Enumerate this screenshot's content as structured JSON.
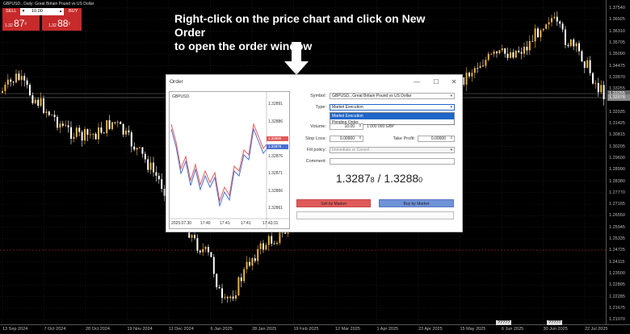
{
  "chart": {
    "symbol_info": "GBPUSD., Daily:  Great Britain Pound vs US Dollar",
    "colors": {
      "bull": "#f0b43c",
      "bear": "#ffffff",
      "grid": "#2a2a2a",
      "price_line_red": "#c72a2a"
    }
  },
  "one_click": {
    "sell_label": "SELL",
    "buy_label": "BUY",
    "lot_value": "10.00",
    "sell_price_prefix": "1.32",
    "sell_price_big": "87",
    "sell_price_sup": "8",
    "buy_price_prefix": "1.32",
    "buy_price_big": "88",
    "buy_price_sup": "0"
  },
  "instruction": {
    "line1": "Right-click on the price chart and click on New Order",
    "line2": "to open the order window"
  },
  "price_scale": {
    "ticks": [
      "1.37540",
      "1.36925",
      "1.36310",
      "1.35705",
      "1.35090",
      "1.34475",
      "1.33870",
      "1.33255",
      "1.32645",
      "1.32035",
      "1.31425",
      "1.30815",
      "1.30205",
      "1.29600",
      "1.28990",
      "1.28380",
      "1.27770",
      "1.27165",
      "1.26550",
      "1.25945",
      "1.25335",
      "1.24725",
      "1.24115",
      "1.23500",
      "1.22895",
      "1.22285",
      "1.21675",
      "1.21070"
    ],
    "tag_gray_1": "1.33255",
    "tag_gray_2": "1.32878"
  },
  "date_axis": {
    "labels": [
      "13 Sep 2024",
      "7 Oct 2024",
      "28 Oct 2024",
      "19 Nov 2024",
      "11 Dec 2024",
      "6 Jan 2025",
      "28 Jan 2025",
      "19 Feb 2025",
      "12 Mar 2025",
      "1 Apr 2025",
      "23 Apr 2025",
      "15 May 2025",
      "6 Jun 2025",
      "30 Jun 2025",
      "22 Jul 2025"
    ],
    "tag_1": "?????",
    "tag_2": "?????"
  },
  "order_dialog": {
    "title": "Order",
    "minimize_glyph": "—",
    "maximize_glyph": "☐",
    "close_glyph": "✕",
    "mini_chart": {
      "symbol": "GBPUSD.",
      "prices": [
        "1.32891",
        "1.32886",
        "1.32881",
        "1.32876",
        "1.32871",
        "1.32866",
        "1.32861"
      ],
      "tag_bid": "1.32880",
      "tag_ask": "1.32878",
      "times": [
        "2025.07.30",
        "17:40",
        "17:41",
        "17:41",
        "17:43:31"
      ]
    },
    "form": {
      "symbol_label": "Symbol:",
      "symbol_value": "GBPUSD., Great Britain Pound vs US Dollar",
      "type_label": "Type:",
      "type_value": "Market Execution",
      "type_options": [
        "Market Execution",
        "Pending Order"
      ],
      "volume_label": "Volume:",
      "volume_value": "10.00",
      "volume_info": "1 000 000 GBP",
      "stoploss_label": "Stop Loss:",
      "stoploss_value": "0.00000",
      "takeprofit_label": "Take Profit:",
      "takeprofit_value": "0.00000",
      "fill_label": "Fill policy:",
      "fill_value": "Immediate or Cancel",
      "comment_label": "Comment:",
      "comment_value": ""
    },
    "bid_main": "1.3287",
    "bid_small": "8",
    "separator": " / ",
    "ask_main": "1.3288",
    "ask_small": "0",
    "sell_button": "Sell by Market",
    "buy_button": "Buy by Market"
  }
}
